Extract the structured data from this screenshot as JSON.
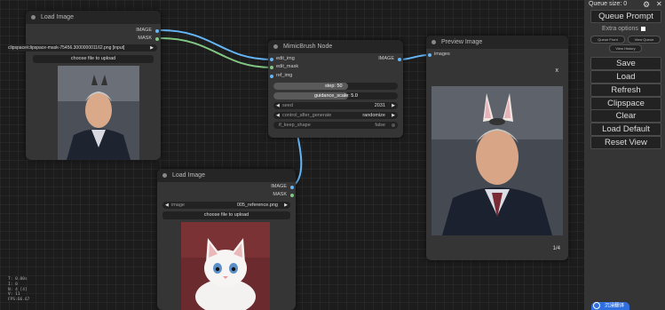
{
  "node_load1": {
    "title": "Load Image",
    "outputs": [
      "IMAGE",
      "MASK"
    ],
    "image_widget_value": "clipspace/clipspace-mask-75456.300000001162.png [input]",
    "upload_label": "choose file to upload"
  },
  "node_mimic": {
    "title": "MimicBrush Node",
    "inputs": [
      "edit_img",
      "edit_mask",
      "ref_img"
    ],
    "output": "IMAGE",
    "step": {
      "label": "step",
      "value": "50"
    },
    "guidance": {
      "label": "guidance_scale",
      "value": "5.0"
    },
    "seed": {
      "label": "seed",
      "value": "2031"
    },
    "control": {
      "label": "control_after_generate",
      "value": "randomize"
    },
    "keep_shape": {
      "label": "if_keep_shape",
      "value": "false"
    }
  },
  "node_preview": {
    "title": "Preview Image",
    "input": "images",
    "close": "x",
    "counter": "1/4"
  },
  "node_load2": {
    "title": "Load Image",
    "outputs": [
      "IMAGE",
      "MASK"
    ],
    "image_label": "image",
    "image_value": "005_reference.png",
    "upload_label": "choose file to upload"
  },
  "sidebar": {
    "queue_size": "Queue size: 0",
    "queue_prompt": "Queue Prompt",
    "extra_options": "Extra options",
    "queue_front": "Queue Front",
    "view_queue": "View Queue",
    "view_history": "View History",
    "buttons": [
      "Save",
      "Load",
      "Refresh",
      "Clipspace",
      "Clear",
      "Load Default",
      "Reset View"
    ]
  },
  "stats": [
    "T: 0.00s",
    "I: 0",
    "N: 4 [4]",
    "V: 11",
    "FPS:66.67"
  ],
  "badge": "沉浸翻译",
  "colors": {
    "image_link": "#64b5f6",
    "mask_link": "#81c784",
    "node_bg": "#353535",
    "canvas_bg": "#1c1c1c"
  }
}
